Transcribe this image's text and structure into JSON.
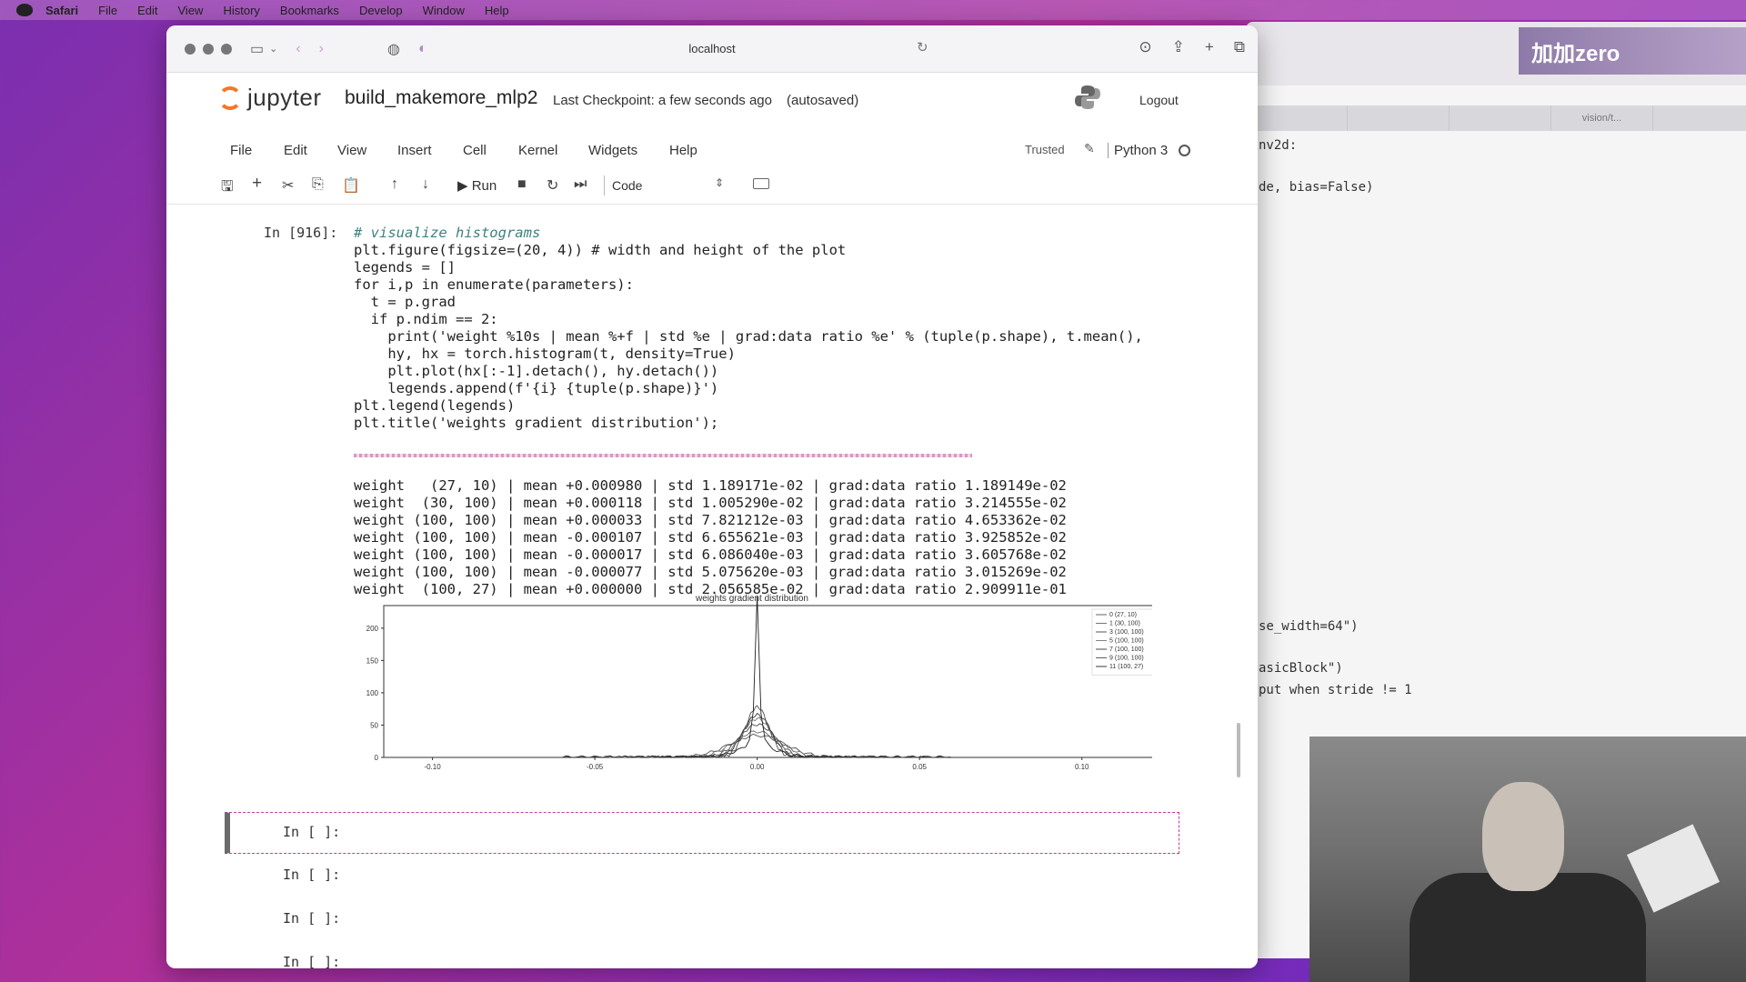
{
  "menubar": {
    "items": [
      "Safari",
      "File",
      "Edit",
      "View",
      "History",
      "Bookmarks",
      "Develop",
      "Window",
      "Help"
    ]
  },
  "browser": {
    "url": "localhost"
  },
  "jupyter": {
    "brand": "jupyter",
    "notebook_name": "build_makemore_mlp2",
    "checkpoint": "Last Checkpoint: a few seconds ago",
    "autosaved": "(autosaved)",
    "logout": "Logout",
    "menu": [
      "File",
      "Edit",
      "View",
      "Insert",
      "Cell",
      "Kernel",
      "Widgets",
      "Help"
    ],
    "trusted": "Trusted",
    "kernel": "Python 3",
    "run_label": "Run",
    "cell_type": "Code"
  },
  "cells": {
    "code_prompt": "In [916]:",
    "empty_prompt": "In [ ]:",
    "code_lines": [
      "# visualize histograms",
      "plt.figure(figsize=(20, 4)) # width and height of the plot",
      "legends = []",
      "for i,p in enumerate(parameters):",
      "  t = p.grad",
      "  if p.ndim == 2:",
      "    print('weight %10s | mean %+f | std %e | grad:data ratio %e' % (tuple(p.shape), t.mean(),",
      "    hy, hx = torch.histogram(t, density=True)",
      "    plt.plot(hx[:-1].detach(), hy.detach())",
      "    legends.append(f'{i} {tuple(p.shape)}')",
      "plt.legend(legends)",
      "plt.title('weights gradient distribution');"
    ],
    "output_lines": [
      "weight   (27, 10) | mean +0.000980 | std 1.189171e-02 | grad:data ratio 1.189149e-02",
      "weight  (30, 100) | mean +0.000118 | std 1.005290e-02 | grad:data ratio 3.214555e-02",
      "weight (100, 100) | mean +0.000033 | std 7.821212e-03 | grad:data ratio 4.653362e-02",
      "weight (100, 100) | mean -0.000107 | std 6.655621e-03 | grad:data ratio 3.925852e-02",
      "weight (100, 100) | mean -0.000017 | std 6.086040e-03 | grad:data ratio 3.605768e-02",
      "weight (100, 100) | mean -0.000077 | std 5.075620e-03 | grad:data ratio 3.015269e-02",
      "weight  (100, 27) | mean +0.000000 | std 2.056585e-02 | grad:data ratio 2.909911e-01"
    ]
  },
  "back_window": {
    "banner": "加加zero",
    "tab_label": "vision/t...",
    "code_lines": [
      "nv2d:",
      "de, bias=False)",
      "se_width=64\")",
      "asicBlock\")",
      "put when stride != 1"
    ]
  },
  "chart_data": {
    "type": "line",
    "title": "weights gradient distribution",
    "x_ticks": [
      "-0.10",
      "-0.05",
      "0.00",
      "0.05",
      "0.10"
    ],
    "y_ticks": [
      "0",
      "50",
      "100",
      "150",
      "200"
    ],
    "xlim": [
      -0.115,
      0.125
    ],
    "ylim": [
      0,
      235
    ],
    "legend": [
      "0 (27, 10)",
      "1 (30, 100)",
      "3 (100, 100)",
      "5 (100, 100)",
      "7 (100, 100)",
      "9 (100, 100)",
      "11 (100, 27)"
    ],
    "legend_position": "top-right",
    "series": [
      {
        "name": "0 (27, 10)",
        "std": 0.0119,
        "peak": 34
      },
      {
        "name": "1 (30, 100)",
        "std": 0.0101,
        "peak": 40
      },
      {
        "name": "3 (100, 100)",
        "std": 0.0078,
        "peak": 51
      },
      {
        "name": "5 (100, 100)",
        "std": 0.0067,
        "peak": 60
      },
      {
        "name": "7 (100, 100)",
        "std": 0.0061,
        "peak": 66
      },
      {
        "name": "9 (100, 100)",
        "std": 0.0051,
        "peak": 78
      },
      {
        "name": "11 (100, 27)",
        "std": 0.0206,
        "peak": 232
      }
    ]
  }
}
